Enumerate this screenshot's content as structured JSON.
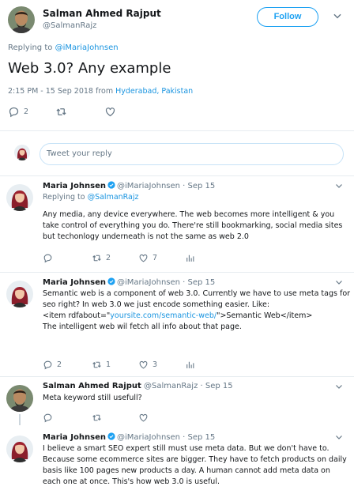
{
  "main_tweet": {
    "author_name": "Salman Ahmed Rajput",
    "author_handle": "@SalmanRajz",
    "follow_label": "Follow",
    "replying_prefix": "Replying to ",
    "replying_to": "@iMariaJohnsen",
    "text": "Web 3.0? Any example",
    "time": "2:15 PM - 15 Sep 2018 from ",
    "location": "Hyderabad, Pakistan",
    "reply_count": "2",
    "retweet_count": "",
    "like_count": ""
  },
  "reply_box": {
    "placeholder": "Tweet your reply"
  },
  "replies": [
    {
      "author_name": "Maria Johnsen",
      "verified": true,
      "handle_date": "@iMariaJohnsen · Sep 15",
      "replying_prefix": "Replying to ",
      "replying_to": "@SalmanRajz",
      "lines": [
        "Any media, any device everywhere. The web becomes more intelligent & you",
        "take control of everything you do. There're still bookmarking, social media sites",
        "but techonlogy underneath is not the same as web 2.0"
      ],
      "reply_count": "",
      "retweet_count": "2",
      "like_count": "7"
    },
    {
      "author_name": "Maria Johnsen",
      "verified": true,
      "handle_date": "@iMariaJohnsen · Sep 15",
      "line1": "Semantic web is a component of web 3.0. Currently we have to use meta tags for",
      "line2": "seo right? In web 3.0 we just encode something easier. Like:",
      "line3_prefix": "<item rdfabout=\"",
      "line3_link": "yoursite.com/semantic-web/",
      "line3_suffix": "\">Semantic Web</item>",
      "line4": "The intelligent web wil fetch all info about that page.",
      "reply_count": "2",
      "retweet_count": "1",
      "like_count": "3"
    },
    {
      "author_name": "Salman Ahmed Rajput",
      "verified": false,
      "handle_date": "@SalmanRajz · Sep 15",
      "lines": [
        "Meta keyword still usefull?"
      ],
      "reply_count": "",
      "retweet_count": "",
      "like_count": ""
    },
    {
      "author_name": "Maria Johnsen",
      "verified": true,
      "handle_date": "@iMariaJohnsen · Sep 15",
      "lines": [
        "I believe a smart SEO expert still must use meta data. But we don't have to.",
        "Because some ecommerce sites are bigger. They have to fetch products on daily",
        "basis like 100 pages new products a day. A human cannot add meta data on",
        "each one at once. This's how web 3.0 is useful."
      ]
    }
  ],
  "colors": {
    "accent": "#1da1f2",
    "link": "#1b95e0",
    "muted": "#657786",
    "border": "#e6ecf0"
  }
}
